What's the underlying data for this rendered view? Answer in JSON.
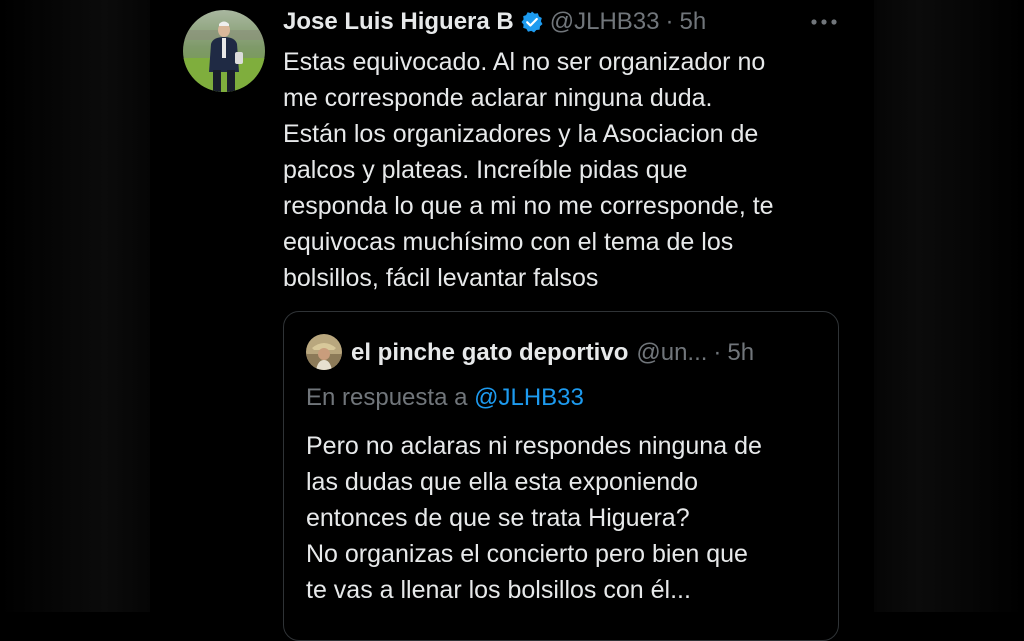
{
  "tweet": {
    "display_name": "Jose Luis Higuera B",
    "handle": "@JLHB33",
    "separator": "·",
    "time": "5h",
    "more_icon": "ellipsis-icon",
    "verified_icon": "verified-badge-icon",
    "text": "Estas equivocado. Al no ser organizador no\nme corresponde aclarar ninguna duda.\nEstán los organizadores y la Asociacion de\npalcos y plateas. Increíble pidas que\nresponda lo que a mi no me corresponde, te\nequivocas muchísimo con el tema de los\nbolsillos, fácil levantar falsos"
  },
  "quote": {
    "display_name": "el pinche gato deportivo",
    "handle": "@un...",
    "separator": "·",
    "time": "5h",
    "reply_prefix": "En respuesta a",
    "reply_mention": "@JLHB33",
    "text": "Pero no aclaras ni respondes ninguna de\nlas dudas que ella esta exponiendo\nentonces de que se trata Higuera?\nNo organizas el concierto pero bien que\nte vas a llenar los bolsillos con él..."
  },
  "colors": {
    "background": "#000000",
    "text_primary": "#e7e9ea",
    "text_secondary": "#71767b",
    "link": "#1d9bf0",
    "verified": "#1d9bf0",
    "border": "#2f3336"
  }
}
